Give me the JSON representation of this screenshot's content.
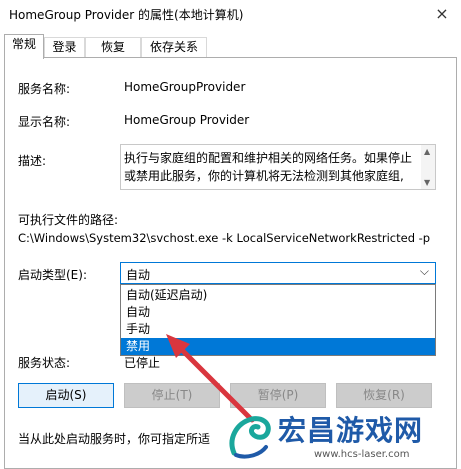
{
  "window": {
    "title": "HomeGroup Provider 的属性(本地计算机)",
    "close_glyph": "×"
  },
  "tabs": [
    {
      "label": "常规",
      "active": true
    },
    {
      "label": "登录",
      "active": false
    },
    {
      "label": "恢复",
      "active": false
    },
    {
      "label": "依存关系",
      "active": false
    }
  ],
  "general": {
    "service_name_label": "服务名称:",
    "service_name_value": "HomeGroupProvider",
    "display_name_label": "显示名称:",
    "display_name_value": "HomeGroup Provider",
    "description_label": "描述:",
    "description_line1": "执行与家庭组的配置和维护相关的网络任务。如果停止",
    "description_line2": "或禁用此服务，你的计算机将无法检测到其他家庭组,",
    "exe_path_label": "可执行文件的路径:",
    "exe_path_value": "C:\\Windows\\System32\\svchost.exe -k LocalServiceNetworkRestricted -p",
    "startup_type_label": "启动类型(E):",
    "startup_type_selected": "自动",
    "startup_type_options": [
      {
        "label": "自动(延迟启动)",
        "highlighted": false
      },
      {
        "label": "自动",
        "highlighted": false
      },
      {
        "label": "手动",
        "highlighted": false
      },
      {
        "label": "禁用",
        "highlighted": true
      }
    ],
    "service_status_label": "服务状态:",
    "service_status_value": "已停止",
    "buttons": {
      "start": "启动(S)",
      "stop": "停止(T)",
      "pause": "暂停(P)",
      "resume": "恢复(R)"
    },
    "hint_text": "当从此处启动服务时，你可指定所适"
  },
  "watermark": {
    "text": "宏昌游戏网",
    "url": "www.hcs-laser.com",
    "color": "#1f5aa8"
  },
  "accent_colors": {
    "selection": "#0078d7",
    "annotation_arrow": "#d9363e"
  }
}
